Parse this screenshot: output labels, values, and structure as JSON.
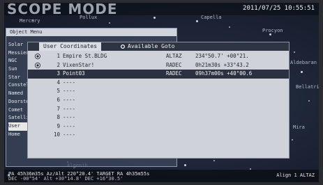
{
  "header": {
    "mode_title": "SCOPE MODE",
    "datetime": "2011/07/25 10:55:51"
  },
  "sky": {
    "labels": [
      "Mercury",
      "Pollux",
      "Capella",
      "Procyon",
      "Aldebaran",
      "Bellatrix",
      "Mira",
      "Algenib"
    ]
  },
  "object_menu": {
    "title": "Object Menu",
    "items": [
      "Solar",
      "Messier",
      "NGC",
      "Sun",
      "Star",
      "Constellation",
      "Named",
      "Doorstep",
      "Comet",
      "Satellite",
      "User",
      "Home"
    ],
    "selected_index": 10
  },
  "coord_panel": {
    "tab_user": "User Coordinates",
    "tab_goto": "Available Goto",
    "rows": [
      {
        "num": "1",
        "name": "Empire St.BLDG",
        "sys": "ALTAZ",
        "value": "234°50.7' +00°21.",
        "selected": false,
        "radio": "on"
      },
      {
        "num": "2",
        "name": "VixenStar!",
        "sys": "RADEC",
        "value": "0h21m30s +33°43.2",
        "selected": false,
        "radio": "on"
      },
      {
        "num": "3",
        "name": "Point03",
        "sys": "RADEC",
        "value": "09h37m00s +40°00.6",
        "selected": true,
        "radio": "none"
      },
      {
        "num": "4",
        "name": "----",
        "sys": "",
        "value": "",
        "selected": false,
        "radio": "none"
      },
      {
        "num": "5",
        "name": "----",
        "sys": "",
        "value": "",
        "selected": false,
        "radio": "none"
      },
      {
        "num": "6",
        "name": "----",
        "sys": "",
        "value": "",
        "selected": false,
        "radio": "none"
      },
      {
        "num": "7",
        "name": "----",
        "sys": "",
        "value": "",
        "selected": false,
        "radio": "none"
      },
      {
        "num": "8",
        "name": "----",
        "sys": "",
        "value": "",
        "selected": false,
        "radio": "none"
      },
      {
        "num": "9",
        "name": "----",
        "sys": "",
        "value": "",
        "selected": false,
        "radio": "none"
      },
      {
        "num": "10",
        "name": "----",
        "sys": "",
        "value": "",
        "selected": false,
        "radio": "none"
      }
    ]
  },
  "status": {
    "row1": "PA  45h36m35s  Az/Alt  220°20.4'    TARGET  RA  4h35m55s",
    "row2": "DEC  -00°54'  Alt  +30°14.8'          DEC  +16°30.5'",
    "right": "Align 1  ALTAZ"
  },
  "colors": {
    "selected_row_bg": "#2b3140",
    "panel_bg": "#cfd3d9",
    "header_bg": "#2d3442"
  }
}
